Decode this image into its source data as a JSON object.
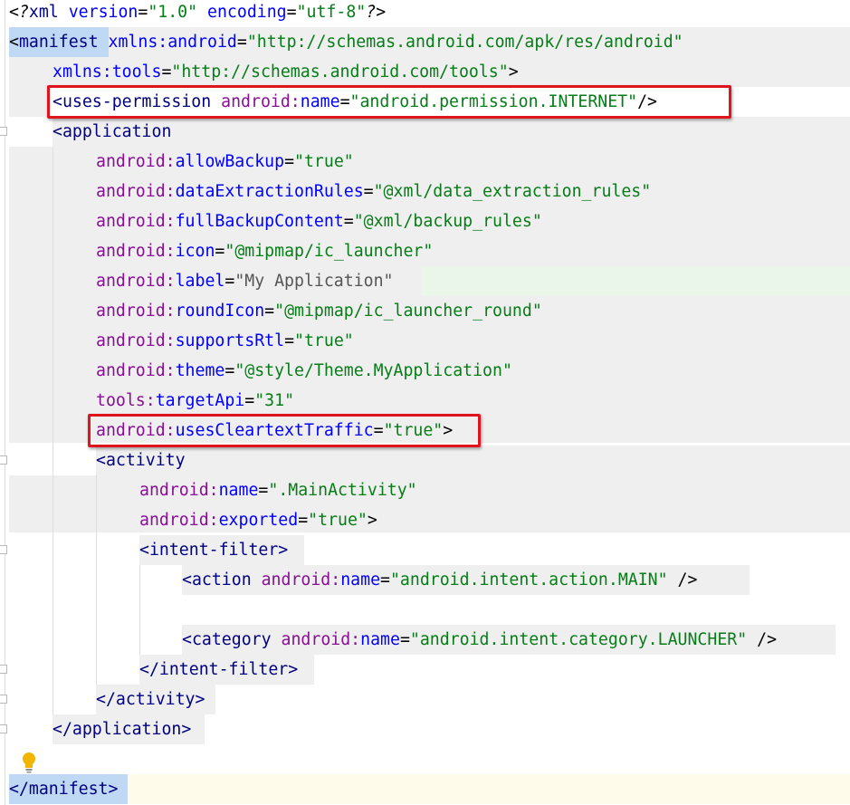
{
  "xml_decl": {
    "open": "<?",
    "name": "xml",
    "attr1": "version",
    "val1": "\"1.0\"",
    "attr2": "encoding",
    "val2": "\"utf-8\"",
    "close": "?>"
  },
  "manifest": {
    "open_lt": "<",
    "tag": "manifest",
    "xmlns_android_attr": "xmlns:android",
    "xmlns_android_val": "\"http://schemas.android.com/apk/res/android\"",
    "xmlns_tools_attr": "xmlns:tools",
    "xmlns_tools_val": "\"http://schemas.android.com/tools\"",
    "close": "</manifest>"
  },
  "uses_permission": {
    "tag": "<uses-permission",
    "ns": "android:",
    "attr": "name",
    "val": "\"android.permission.INTERNET\"",
    "end": "/>"
  },
  "application": {
    "tag": "<application",
    "attrs": [
      {
        "ns": "android:",
        "name": "allowBackup",
        "val": "\"true\""
      },
      {
        "ns": "android:",
        "name": "dataExtractionRules",
        "val": "\"@xml/data_extraction_rules\""
      },
      {
        "ns": "android:",
        "name": "fullBackupContent",
        "val": "\"@xml/backup_rules\""
      },
      {
        "ns": "android:",
        "name": "icon",
        "val": "\"@mipmap/ic_launcher\""
      },
      {
        "ns": "android:",
        "name": "label",
        "val": "\"My Application\""
      },
      {
        "ns": "android:",
        "name": "roundIcon",
        "val": "\"@mipmap/ic_launcher_round\""
      },
      {
        "ns": "android:",
        "name": "supportsRtl",
        "val": "\"true\""
      },
      {
        "ns": "android:",
        "name": "theme",
        "val": "\"@style/Theme.MyApplication\""
      },
      {
        "ns": "tools:",
        "name": "targetApi",
        "val": "\"31\""
      },
      {
        "ns": "android:",
        "name": "usesCleartextTraffic",
        "val": "\"true\""
      }
    ],
    "close": "</application>"
  },
  "activity": {
    "tag": "<activity",
    "name_ns": "android:",
    "name_attr": "name",
    "name_val": "\".MainActivity\"",
    "exported_ns": "android:",
    "exported_attr": "exported",
    "exported_val": "\"true\"",
    "close": "</activity>"
  },
  "intent_filter": {
    "tag": "<intent-filter>",
    "action_tag": "<action",
    "action_ns": "android:",
    "action_attr": "name",
    "action_val": "\"android.intent.action.MAIN\"",
    "action_end": "/>",
    "category_tag": "<category",
    "category_ns": "android:",
    "category_attr": "name",
    "category_val": "\"android.intent.category.LAUNCHER\"",
    "category_end": "/>",
    "close": "</intent-filter>"
  },
  "icons": {
    "intention": "lightbulb-icon"
  }
}
